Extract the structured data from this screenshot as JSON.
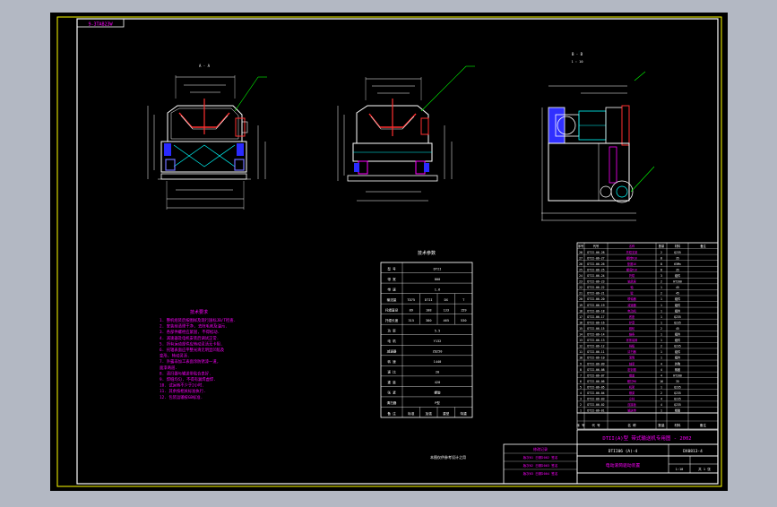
{
  "colors": {
    "workspace": "#b3b8c3",
    "paper": "#000000",
    "frame": "#ffff00",
    "line": "#ffffff",
    "detail": "#00ffff",
    "leader": "#00ff00",
    "note": "#ff00ff",
    "accent": "#ff3030",
    "part": "#7070ff",
    "table": "#ffffff"
  },
  "header": {
    "drawing_tag": "9-3TAB23W"
  },
  "views": {
    "view1_label": "A - A",
    "view3_label": "B - B",
    "view3_sub": "1 : 10"
  },
  "notes": {
    "title": "技术要求",
    "lines": [
      "1. 整机组装后按图样及现行国标JB/T检查.",
      "2. 安装前清理干净, 去除毛刺及油污.",
      "3. 各部件螺栓应紧固, 不得松动.",
      "4. 减速器及电机安装后调试正常.",
      "5. 所有运动部件应转动灵活无卡阻.",
      "6. 托辊表面应平整光滑无明显凹陷及",
      "   变形, 转动灵活.",
      "7. 外露非加工表面涂防锈漆一道,",
      "   面漆两道.",
      "8. 清扫器与输送带贴合良好.",
      "9. 焊缝均匀, 不得有漏焊虚焊.",
      "10. 试运转不少于2小时.",
      "11. 其余按相关标准执行.",
      "12. 包装运输按GB标准."
    ]
  },
  "spec_table": {
    "title": "技术参数",
    "caption": "本图仅供参考设计之用",
    "rows": [
      [
        "型 号",
        "DTII"
      ],
      [
        "带 宽",
        "800"
      ],
      [
        "带 速",
        "1.6"
      ],
      [
        "输送量",
        "TD75",
        "DTII",
        "DX",
        "T"
      ],
      [
        "托辊直径",
        "89",
        "108",
        "133",
        "159"
      ],
      [
        "托辊长度",
        "315",
        "380",
        "465",
        "530"
      ],
      [
        "功 率",
        "5.5"
      ],
      [
        "电 机",
        "Y132"
      ],
      [
        "减速器",
        "ZQ250"
      ],
      [
        "转 速",
        "1440"
      ],
      [
        "速 比",
        "20"
      ],
      [
        "重 量",
        "420"
      ],
      [
        "张 紧",
        "螺旋"
      ],
      [
        "清扫器",
        "P型"
      ],
      [
        "备 注",
        "标准",
        "加强",
        "重型",
        "特重"
      ]
    ]
  },
  "parts_list": {
    "header": [
      "序号",
      "代号",
      "名称",
      "数量",
      "材料",
      "备注"
    ],
    "rows": [
      [
        "28",
        "DTII-06-28",
        "托辊支架",
        "2",
        "Q235",
        ""
      ],
      [
        "27",
        "DTII-06-27",
        "螺栓M16",
        "8",
        "35",
        ""
      ],
      [
        "26",
        "DTII-06-26",
        "垫圈16",
        "8",
        "65Mn",
        ""
      ],
      [
        "25",
        "DTII-06-25",
        "螺母M16",
        "8",
        "35",
        ""
      ],
      [
        "24",
        "DTII-06-24",
        "托辊",
        "3",
        "组件",
        ""
      ],
      [
        "23",
        "DTII-06-23",
        "轴承座",
        "2",
        "HT200",
        ""
      ],
      [
        "22",
        "DTII-06-22",
        "轴",
        "1",
        "45",
        ""
      ],
      [
        "21",
        "DTII-06-21",
        "键",
        "2",
        "45",
        ""
      ],
      [
        "20",
        "DTII-06-20",
        "联轴器",
        "1",
        "组件",
        ""
      ],
      [
        "19",
        "DTII-06-19",
        "减速器",
        "1",
        "组件",
        ""
      ],
      [
        "18",
        "DTII-06-18",
        "电动机",
        "1",
        "组件",
        ""
      ],
      [
        "17",
        "DTII-06-17",
        "底座",
        "1",
        "Q235",
        ""
      ],
      [
        "16",
        "DTII-06-16",
        "护罩",
        "1",
        "Q235",
        ""
      ],
      [
        "15",
        "DTII-06-15",
        "链轮",
        "2",
        "45",
        ""
      ],
      [
        "14",
        "DTII-06-14",
        "链条",
        "1",
        "组件",
        ""
      ],
      [
        "13",
        "DTII-06-13",
        "张紧装置",
        "1",
        "组件",
        ""
      ],
      [
        "12",
        "DTII-06-12",
        "挡板",
        "2",
        "Q235",
        ""
      ],
      [
        "11",
        "DTII-06-11",
        "清扫器",
        "1",
        "组件",
        ""
      ],
      [
        "10",
        "DTII-06-10",
        "滚筒",
        "1",
        "组件",
        ""
      ],
      [
        "9",
        "DTII-06-09",
        "轴承",
        "4",
        "外购",
        ""
      ],
      [
        "8",
        "DTII-06-08",
        "密封圈",
        "4",
        "橡胶",
        ""
      ],
      [
        "7",
        "DTII-06-07",
        "端盖",
        "4",
        "HT200",
        ""
      ],
      [
        "6",
        "DTII-06-06",
        "螺钉M8",
        "16",
        "35",
        ""
      ],
      [
        "5",
        "DTII-06-05",
        "机架",
        "1",
        "Q235",
        ""
      ],
      [
        "4",
        "DTII-06-04",
        "横梁",
        "2",
        "Q235",
        ""
      ],
      [
        "3",
        "DTII-06-03",
        "立柱",
        "4",
        "Q235",
        ""
      ],
      [
        "2",
        "DTII-06-02",
        "连接板",
        "4",
        "Q235",
        ""
      ],
      [
        "1",
        "DTII-06-01",
        "输送带",
        "1",
        "橡胶",
        ""
      ]
    ],
    "footer": [
      "序 号",
      "代 号",
      "名 称",
      "数量",
      "材料",
      "备注"
    ]
  },
  "title_block": {
    "title_line": "DTII(A)型 带式输送机专用图 - 2002",
    "code_left": "DTII06 (A)-4",
    "code_right": "DX0813-4",
    "name": "电动滚筒驱动装置",
    "scale": "1:10",
    "sheet": "共 1 张"
  },
  "revision_block": {
    "title": "修改记录",
    "rows": [
      "版次01  日期2002  签名",
      "版次02  日期2003  签名",
      "版次03  日期2004  签名"
    ]
  }
}
